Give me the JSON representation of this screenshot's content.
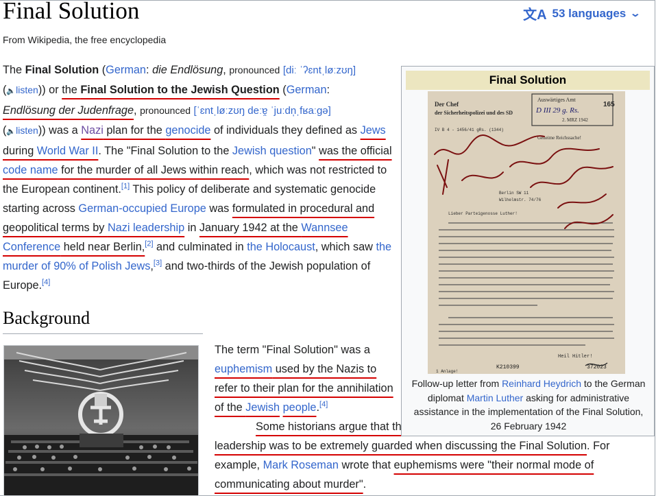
{
  "page": {
    "title": "Final Solution",
    "languages": "53 languages",
    "tagline": "From Wikipedia, the free encyclopedia"
  },
  "lead": {
    "t1": "The ",
    "b1": "Final Solution",
    "t2": " (",
    "l_german1": "German",
    "t3": ": ",
    "i1": "die Endlösung",
    "t4": ", ",
    "pron1": "pronounced",
    "t5": " ",
    "ipa1": "[diː ˈʔɛntˌløːzʊŋ]",
    "t6": " (",
    "listen1": "listen",
    "t7": ")) or ",
    "ul_the1": "the ",
    "b2": "Final Solution to the Jewish Question",
    "t8": " (",
    "l_german2": "German",
    "t9": ": ",
    "i2": "Endlösung der Judenfrage",
    "t10": ", ",
    "pron2": "pronounced",
    "t11": " ",
    "ipa2": "[ˈɛntˌløːzʊŋ deːɐ̯ ˈjuːdn̩ˌfʁaːɡə]",
    "t12": " (",
    "listen2": "listen",
    "t13": ")) was a ",
    "l_nazi": "Nazi",
    "t14": " plan for the ",
    "l_genocide": "genocide",
    "t15": " of individuals they defined as ",
    "l_jews": "Jews",
    "t16": " during ",
    "l_ww2": "World War II",
    "t17": ". The \"Final Solution to the ",
    "l_jq": "Jewish question",
    "t18": "\" ",
    "u1": "was the official ",
    "l_codename": "code name",
    "u2": " for the murder of all Jews within reach",
    "t19": ", which was not restricted to the European continent.",
    "ref1": "[1]",
    "t20": " This policy of deliberate and systematic genocide starting across ",
    "l_occupied": "German-occupied Europe",
    "t21": " was ",
    "u3": "formulated in procedural and geopolitical terms by ",
    "l_leadership": "Nazi leadership",
    "t22": " in ",
    "u4": "January 1942 at the ",
    "l_wannsee": "Wannsee Conference",
    "u5": " held near Berlin,",
    "ref2": "[2]",
    "t23": " and culminated in ",
    "l_holocaust": "the Holocaust",
    "t24": ", which saw ",
    "l_murder": "the murder of 90% of Polish Jews",
    "t25": ",",
    "ref3": "[3]",
    "t26": " and two-thirds of the Jewish population of Europe.",
    "ref4": "[4]"
  },
  "background": {
    "heading": "Background",
    "p1": "The term \"Final Solution\" was a ",
    "l_euphemism": "euphemism",
    "p2": " used by the Nazis to refer to their plan for the annihilation of the ",
    "l_jewish": "Jewish",
    "p3": " ",
    "l_people": "people",
    "p4": ".",
    "ref": "[4]",
    "p5": " Some historians argue that the usual tendency of the German leadership was to be extremely guarded when discussing the Final Solution",
    "p6": ". For example, ",
    "l_roseman": "Mark Roseman",
    "p7": " wrote that ",
    "p8": "euphemisms were \"their normal mode of communicating about murder\"",
    "p9": "."
  },
  "infobox": {
    "title": "Final Solution",
    "caption_a": "Follow-up letter from ",
    "caption_link1": "Reinhard Heydrich",
    "caption_b": " to the German diplomat ",
    "caption_link2": "Martin Luther",
    "caption_c": " asking for administrative assistance in the implementation of the Final Solution, 26 February 1942",
    "doc": {
      "header_left": "Der Chef\nder Sicherheitspolizei und des SD",
      "stamp_top": "Auswärtiges Amt",
      "stamp_num": "D III 29 g. Rs.",
      "stamp_date": "2. MRZ 1942",
      "stamp_165": "165",
      "ref_line": "IV B 4 - 1456/41 gRs. (1344)",
      "secret": "Geheime Reichssache!",
      "place": "Berlin SW 11",
      "street": "Wilhelmstr. 74/76",
      "greeting": "Lieber Parteigenosse Luther!",
      "closing": "Heil Hitler!",
      "code_left": "K210399",
      "code_right": "372023",
      "anlage": "1 Anlage!",
      "hand1": "Vg. Rademacher",
      "hand2": "bitte vorlegen"
    }
  },
  "icons": {
    "language": "translate-icon",
    "chevron": "chevron-down-icon",
    "speaker": "speaker-icon"
  },
  "colors": {
    "link": "#3366cc",
    "visited": "#6b4ba1",
    "annotation": "#d40000"
  }
}
